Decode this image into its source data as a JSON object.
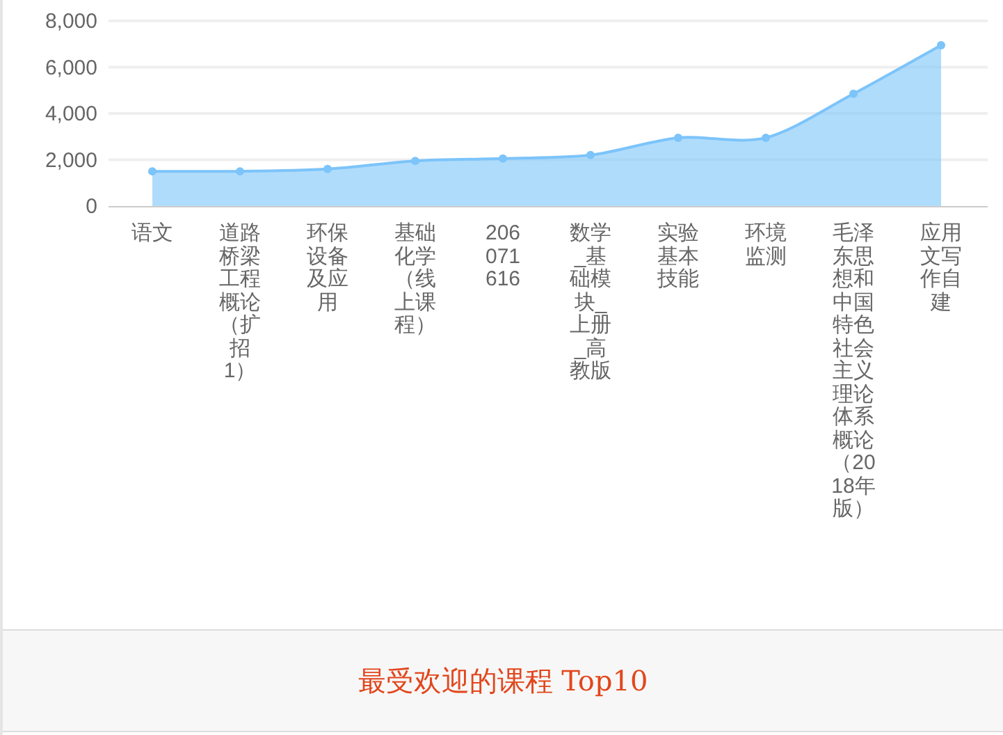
{
  "chart": {
    "title": "最受欢迎的课程 Top10",
    "chart_data": {
      "type": "area",
      "categories": [
        "语文",
        "道路桥梁工程概论（扩招1）",
        "环保设备及应用",
        "基础化学（线上课程）",
        "206071616",
        "数学_基础模块_上册_高教版",
        "实验基本技能",
        "环境监测",
        "毛泽东思想和中国特色社会主义理论体系概论（2018年版）",
        "应用文写作自建"
      ],
      "grid": true,
      "series": [
        {
          "color": "#7cc4fa",
          "values": [
            1500,
            1500,
            1600,
            1950,
            2050,
            2200,
            2950,
            2950,
            4850,
            6950
          ]
        }
      ],
      "ylim": [
        0,
        8000
      ],
      "yticks": [
        {
          "value": 0,
          "label": "0"
        },
        {
          "value": 2000,
          "label": "2,000"
        },
        {
          "value": 4000,
          "label": "4,000"
        },
        {
          "value": 6000,
          "label": "6,000"
        },
        {
          "value": 8000,
          "label": "8,000"
        }
      ]
    }
  }
}
